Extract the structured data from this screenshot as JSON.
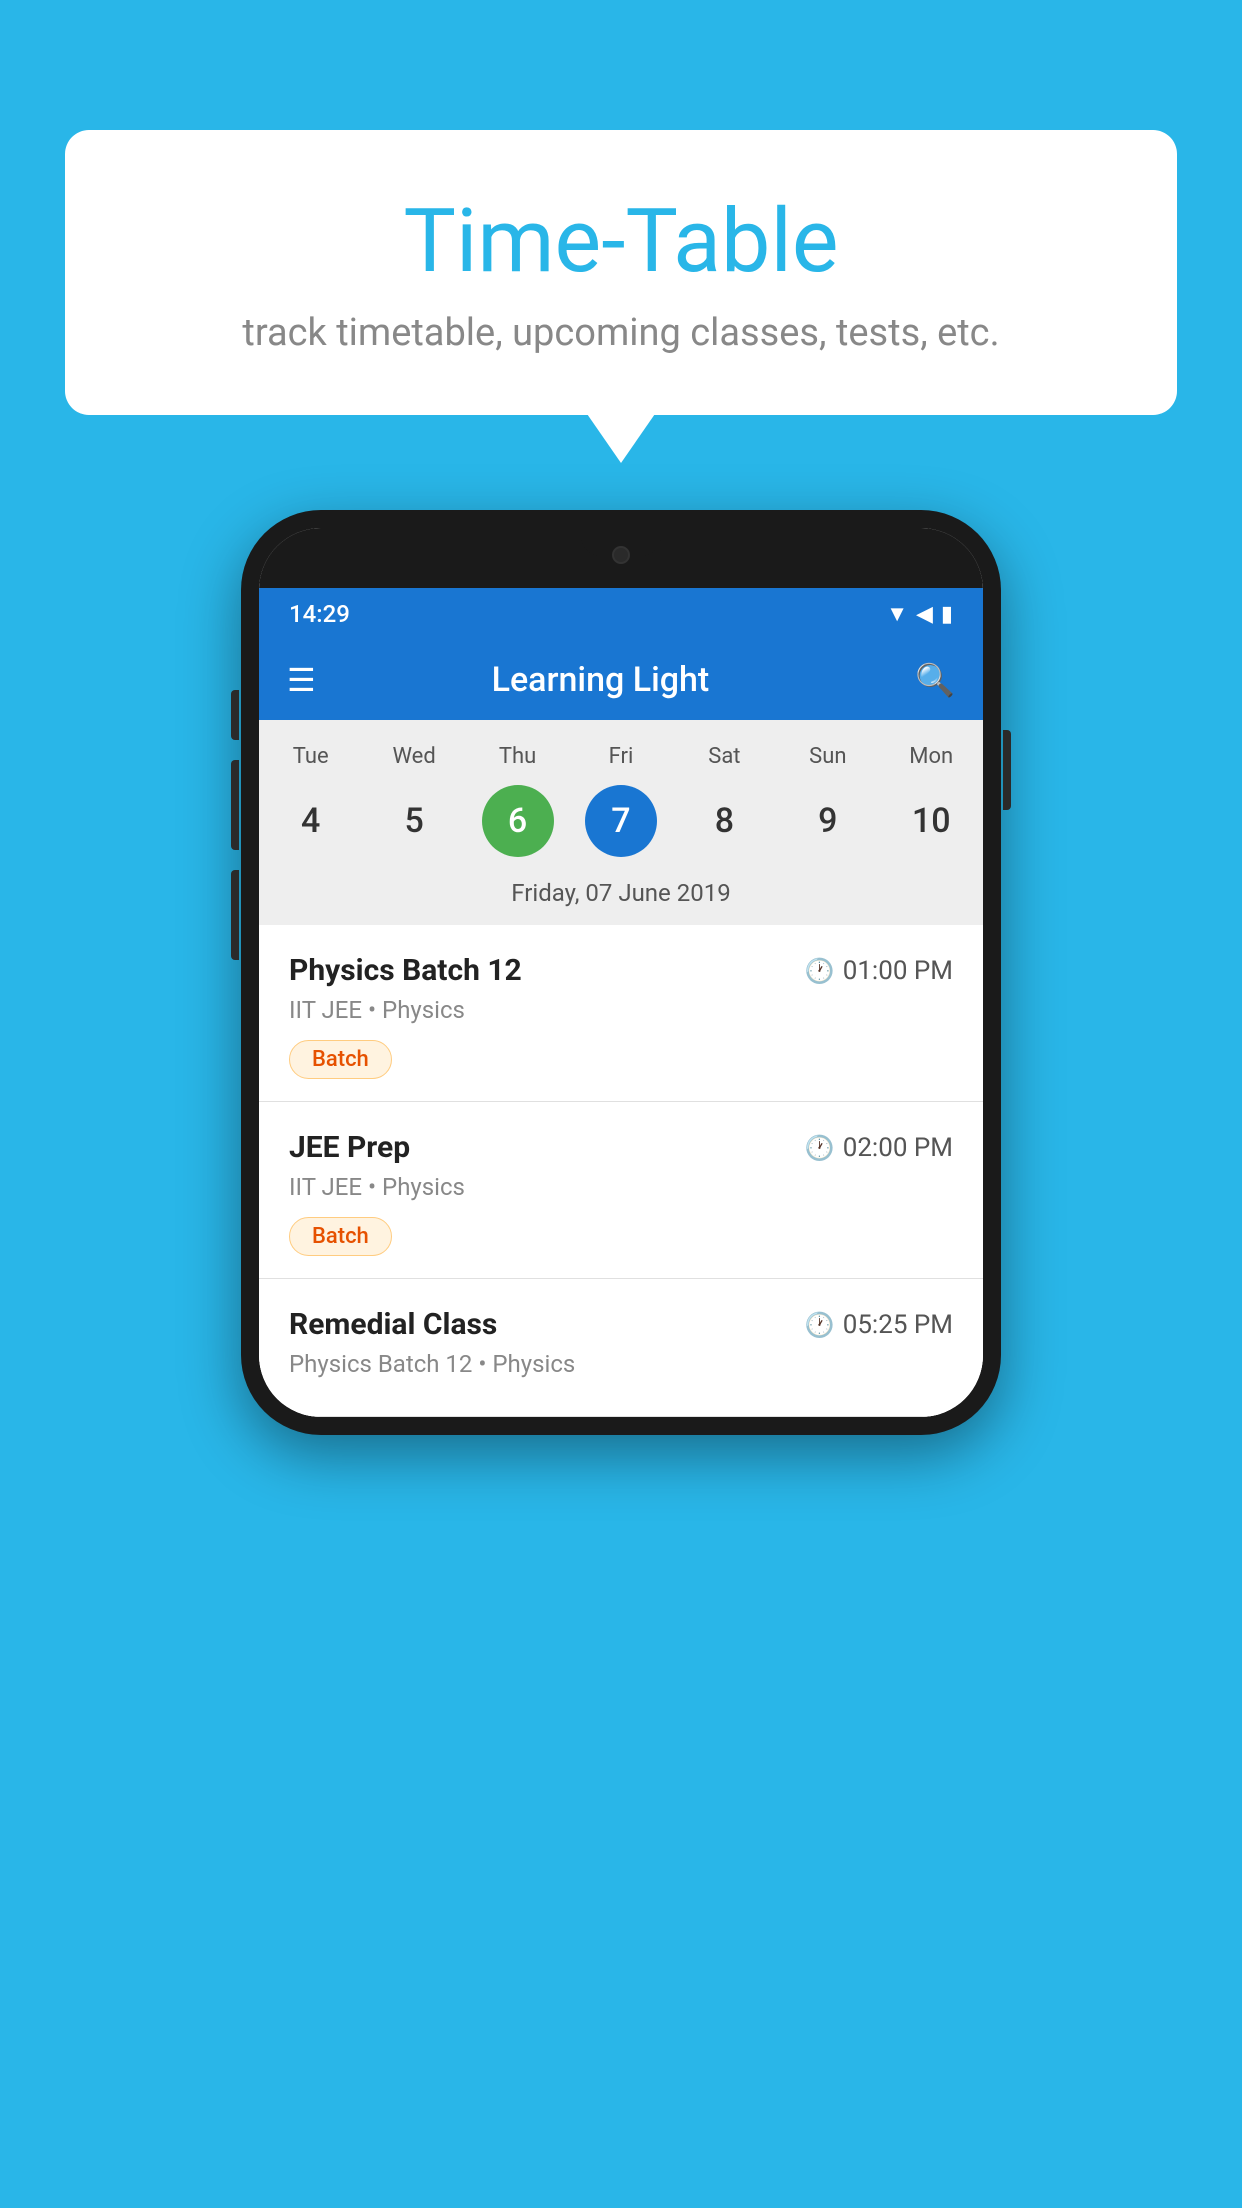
{
  "background_color": "#29B6E8",
  "bubble": {
    "title": "Time-Table",
    "subtitle": "track timetable, upcoming classes, tests, etc."
  },
  "phone": {
    "status_bar": {
      "time": "14:29"
    },
    "app_bar": {
      "title": "Learning Light"
    },
    "calendar": {
      "days": [
        "Tue",
        "Wed",
        "Thu",
        "Fri",
        "Sat",
        "Sun",
        "Mon"
      ],
      "dates": [
        "4",
        "5",
        "6",
        "7",
        "8",
        "9",
        "10"
      ],
      "today_index": 2,
      "selected_index": 3,
      "selected_label": "Friday, 07 June 2019"
    },
    "classes": [
      {
        "name": "Physics Batch 12",
        "time": "01:00 PM",
        "meta": "IIT JEE • Physics",
        "badge": "Batch"
      },
      {
        "name": "JEE Prep",
        "time": "02:00 PM",
        "meta": "IIT JEE • Physics",
        "badge": "Batch"
      },
      {
        "name": "Remedial Class",
        "time": "05:25 PM",
        "meta": "Physics Batch 12 • Physics",
        "badge": null
      }
    ]
  }
}
